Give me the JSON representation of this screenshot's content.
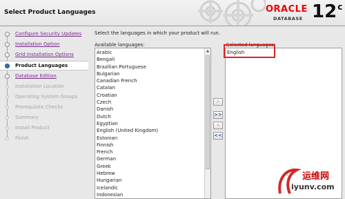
{
  "header": {
    "title": "Select Product Languages",
    "brand": "ORACLE",
    "product": "DATABASE",
    "version": "12",
    "version_suffix": "c"
  },
  "nav": {
    "steps": [
      {
        "label": "Configure Security Updates",
        "state": "done"
      },
      {
        "label": "Installation Option",
        "state": "done"
      },
      {
        "label": "Grid Installation Options",
        "state": "done"
      },
      {
        "label": "Product Languages",
        "state": "current"
      },
      {
        "label": "Database Edition",
        "state": "done"
      },
      {
        "label": "Installation Location",
        "state": "future"
      },
      {
        "label": "Operating System Groups",
        "state": "future"
      },
      {
        "label": "Prerequisite Checks",
        "state": "future"
      },
      {
        "label": "Summary",
        "state": "future"
      },
      {
        "label": "Install Product",
        "state": "future"
      },
      {
        "label": "Finish",
        "state": "future"
      }
    ]
  },
  "main": {
    "instructions": "Select the languages in which your product will run.",
    "available_label": "Available languages:",
    "selected_label": "Selected languages:",
    "available": [
      "Arabic",
      "Bengali",
      "Brazilian Portuguese",
      "Bulgarian",
      "Canadian French",
      "Catalan",
      "Croatian",
      "Czech",
      "Danish",
      "Dutch",
      "Egyptian",
      "English (United Kingdom)",
      "Estonian",
      "Finnish",
      "French",
      "German",
      "Greek",
      "Hebrew",
      "Hungarian",
      "Icelandic",
      "Indonesian"
    ],
    "selected": [
      "English"
    ],
    "buttons": {
      "add": ">",
      "add_all": ">>",
      "remove": "<",
      "remove_all": "<<"
    }
  },
  "watermark": {
    "name": "运维网",
    "url": "iyunv.com"
  },
  "colors": {
    "highlight": "#e02020",
    "brand": "#e00000",
    "visited_link": "#7a2a8c"
  }
}
